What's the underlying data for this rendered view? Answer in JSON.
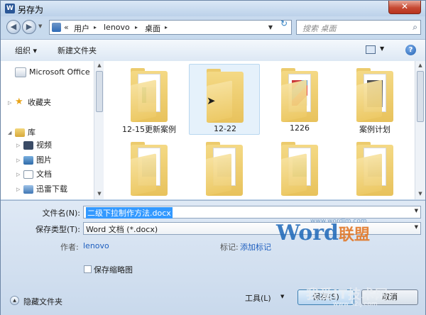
{
  "window": {
    "title": "另存为",
    "close_glyph": "✕",
    "app_icon": "W"
  },
  "address": {
    "chevron": "«",
    "crumbs": [
      "用户",
      "lenovo",
      "桌面"
    ],
    "separator": "▸",
    "search_placeholder": "搜索 桌面"
  },
  "toolbar": {
    "organize": "组织 ▾",
    "new_folder": "新建文件夹",
    "help": "?"
  },
  "nav": [
    {
      "label": "Microsoft Office",
      "icon": "office-icon"
    },
    {
      "label": "收藏夹",
      "icon": "star-icon"
    },
    {
      "label": "库",
      "icon": "library-icon"
    },
    {
      "label": "视频",
      "icon": "video-icon"
    },
    {
      "label": "图片",
      "icon": "picture-icon"
    },
    {
      "label": "文档",
      "icon": "document-icon"
    },
    {
      "label": "迅雷下载",
      "icon": "thunder-icon"
    }
  ],
  "folders": [
    {
      "name": "12-15更新案例",
      "selected": false
    },
    {
      "name": "12-22",
      "selected": true
    },
    {
      "name": "1226",
      "selected": false
    },
    {
      "name": "案例计划",
      "selected": false
    },
    {
      "name": "",
      "selected": false
    },
    {
      "name": "",
      "selected": false
    },
    {
      "name": "",
      "selected": false
    },
    {
      "name": "",
      "selected": false
    }
  ],
  "form": {
    "filename_label": "文件名(N):",
    "filename_value": "二级下拉制作方法.docx",
    "filetype_label": "保存类型(T):",
    "filetype_value": "Word 文档 (*.docx)",
    "author_label": "作者:",
    "author_value": "lenovo",
    "tags_label": "标记:",
    "tags_value": "添加标记",
    "thumbnail_label": "保存缩略图",
    "thumbnail_checked": false
  },
  "footer": {
    "hide_folders": "隐藏文件夹",
    "tools": "工具(L)",
    "save": "保存(S)",
    "cancel": "取消"
  },
  "watermarks": {
    "brand_main": "Word",
    "brand_suffix": "联盟",
    "brand_url": "www.wordlm.com",
    "site_name": "我爱IT技术网",
    "site_url": "www.52ij.com"
  }
}
